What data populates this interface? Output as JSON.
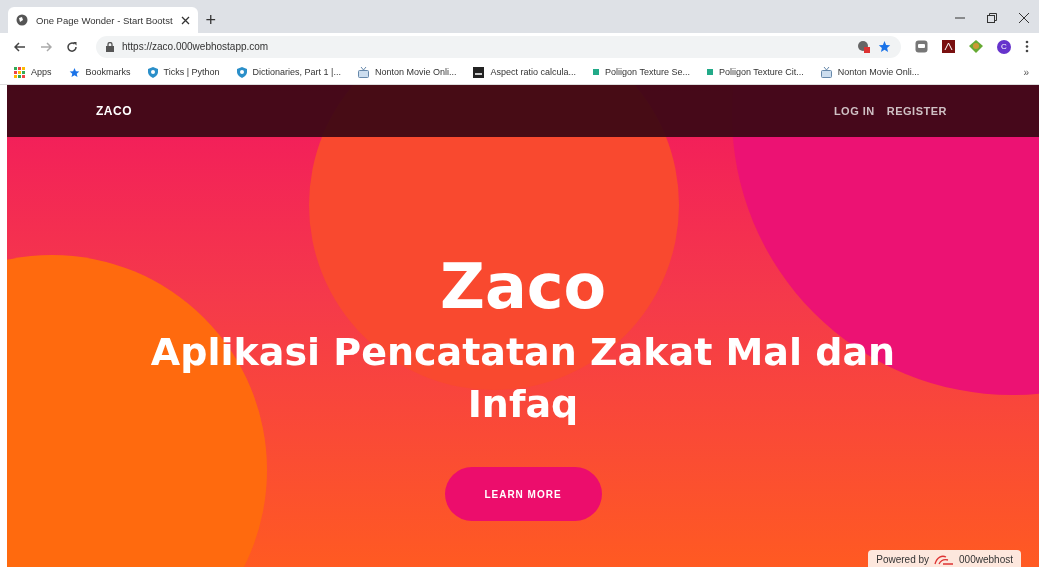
{
  "browser": {
    "tab": {
      "title": "One Page Wonder - Start Bootst",
      "selected": true
    },
    "new_tab": "+",
    "url": "https://zaco.000webhostapp.com",
    "profile": "C",
    "more_bookmarks": "»"
  },
  "bookmarks": [
    {
      "kind": "apps",
      "label": "Apps"
    },
    {
      "kind": "star",
      "label": "Bookmarks"
    },
    {
      "kind": "shield",
      "label": "Ticks | Python"
    },
    {
      "kind": "shield",
      "label": "Dictionaries, Part 1 |..."
    },
    {
      "kind": "tv",
      "label": "Nonton Movie Onli..."
    },
    {
      "kind": "square",
      "label": "Aspect ratio calcula..."
    },
    {
      "kind": "dot",
      "label": "Poliigon Texture Se..."
    },
    {
      "kind": "dot",
      "label": "Poliigon Texture Cit..."
    },
    {
      "kind": "tv",
      "label": "Nonton Movie Onli..."
    }
  ],
  "navbar": {
    "brand": "ZACO",
    "links": [
      "LOG IN",
      "REGISTER"
    ]
  },
  "hero": {
    "title": "Zaco",
    "subtitle": "Aplikasi Pencatatan Zakat Mal dan Infaq",
    "button": "LEARN MORE"
  },
  "badge": {
    "prefix": "Powered by",
    "name": "000webhost"
  }
}
